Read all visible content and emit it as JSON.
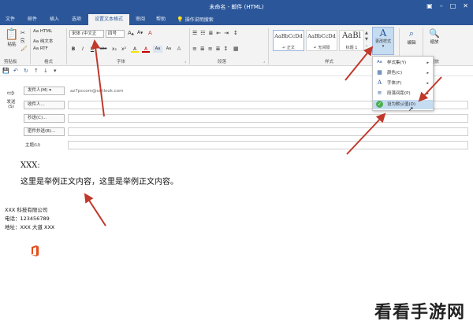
{
  "window": {
    "title": "未命名 - 邮件 (HTML)",
    "controls": [
      "▣",
      "–",
      "□",
      "✕"
    ]
  },
  "tabs": [
    {
      "label": "文件"
    },
    {
      "label": "邮件"
    },
    {
      "label": "插入"
    },
    {
      "label": "选项"
    },
    {
      "label": "设置文本格式"
    },
    {
      "label": "审阅"
    },
    {
      "label": "帮助"
    },
    {
      "label": "操作说明搜索"
    }
  ],
  "ribbon": {
    "clipboard": {
      "paste": "粘贴",
      "label": "剪贴板"
    },
    "format": {
      "html": "Aa HTML",
      "plain": "Aa 纯文本",
      "rtf": "Aa RTF",
      "label": "格式"
    },
    "font": {
      "name": "宋体 (中文正",
      "size": "四号",
      "label": "字体",
      "buttons": [
        "B",
        "I",
        "U",
        "abc",
        "x₂",
        "x²",
        "A",
        "A",
        "Aa",
        "Aa",
        "A"
      ]
    },
    "paragraph": {
      "label": "段落"
    },
    "styles": {
      "label": "样式",
      "items": [
        {
          "sample": "AaBbCcDd",
          "name": "↵ 正文"
        },
        {
          "sample": "AaBbCcDd",
          "name": "↵ 无间隔"
        },
        {
          "sample": "AaBl",
          "name": "标题 1"
        }
      ],
      "change": "更改样式",
      "edit": "编辑",
      "zoom": "缩放",
      "zoom_group": "缩放"
    }
  },
  "style_menu": {
    "items": [
      {
        "label": "样式集(Y)",
        "icon": "Aa"
      },
      {
        "label": "颜色(C)",
        "icon": "▦"
      },
      {
        "label": "字体(F)",
        "icon": "A"
      },
      {
        "label": "段落间距(P)",
        "icon": "≡"
      },
      {
        "label": "设为默认值(D)",
        "icon": "✓"
      }
    ]
  },
  "compose": {
    "send": "发送\n(S)",
    "from_btn": "发件人(M) ▾",
    "from_addr": "az7pccom@outlook.com",
    "to_btn": "收件人...",
    "cc_btn": "抄送(C)...",
    "bcc_btn": "密件抄送(B)...",
    "subject": "主题(U)"
  },
  "body": {
    "greeting": "XXX:",
    "content": "这里是举例正文内容，这里是举例正文内容。",
    "sig_company": "XXX 科技有限公司",
    "sig_phone": "电话：123456789",
    "sig_address": "地址：XXX 大道 XXX"
  },
  "watermark": "看看手游网",
  "colors": {
    "accent": "#2b579a",
    "arrow": "#c0392b",
    "highlight": "#c5dcf1"
  }
}
